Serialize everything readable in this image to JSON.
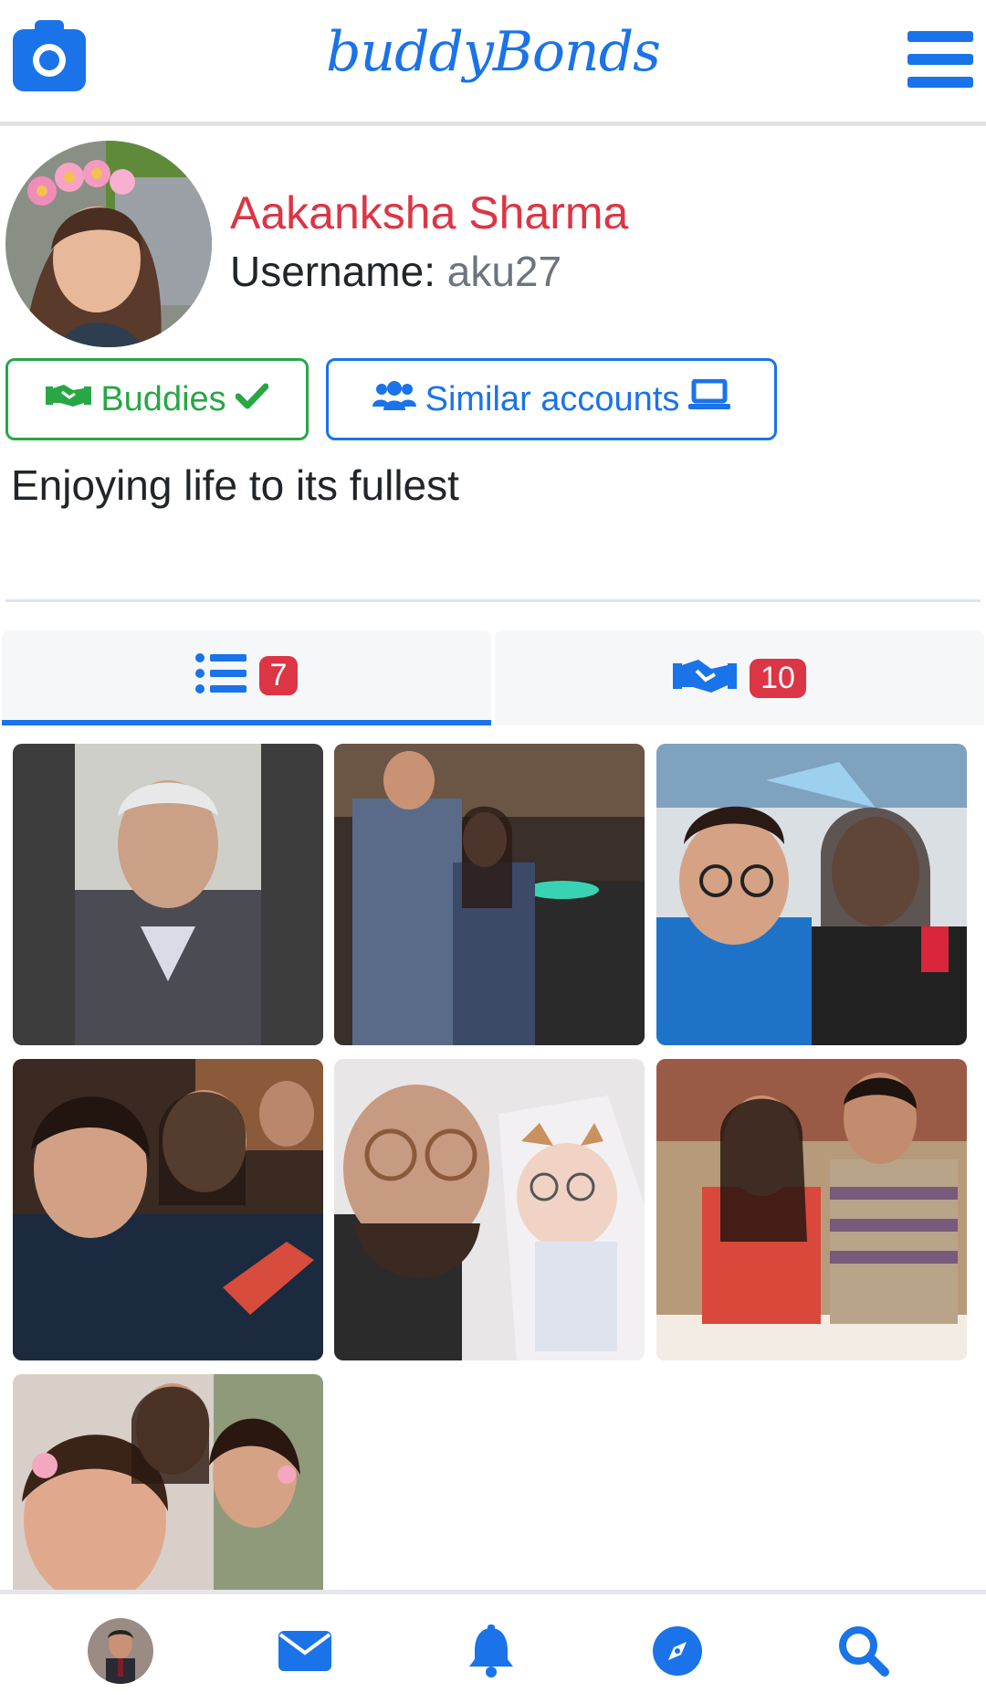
{
  "header": {
    "brand": "buddyBonds",
    "camera_icon": "camera-icon",
    "menu_icon": "hamburger-menu-icon"
  },
  "profile": {
    "name": "Aakanksha Sharma",
    "username_label": "Username:",
    "username_value": "aku27",
    "bio": "Enjoying life to its fullest"
  },
  "actions": {
    "buddies_label": "Buddies",
    "similar_label": "Similar accounts"
  },
  "tabs": [
    {
      "icon": "list-icon",
      "count": "7",
      "active": true
    },
    {
      "icon": "handshake-icon",
      "count": "10",
      "active": false
    }
  ],
  "posts": [
    {
      "alt": "post-1"
    },
    {
      "alt": "post-2"
    },
    {
      "alt": "post-3"
    },
    {
      "alt": "post-4"
    },
    {
      "alt": "post-5"
    },
    {
      "alt": "post-6"
    },
    {
      "alt": "post-7"
    }
  ],
  "bottom_nav": [
    "profile-avatar",
    "messages-icon",
    "notifications-icon",
    "explore-icon",
    "search-icon"
  ],
  "colors": {
    "primary": "#1a73e8",
    "danger": "#dc3545",
    "success": "#28a745"
  }
}
